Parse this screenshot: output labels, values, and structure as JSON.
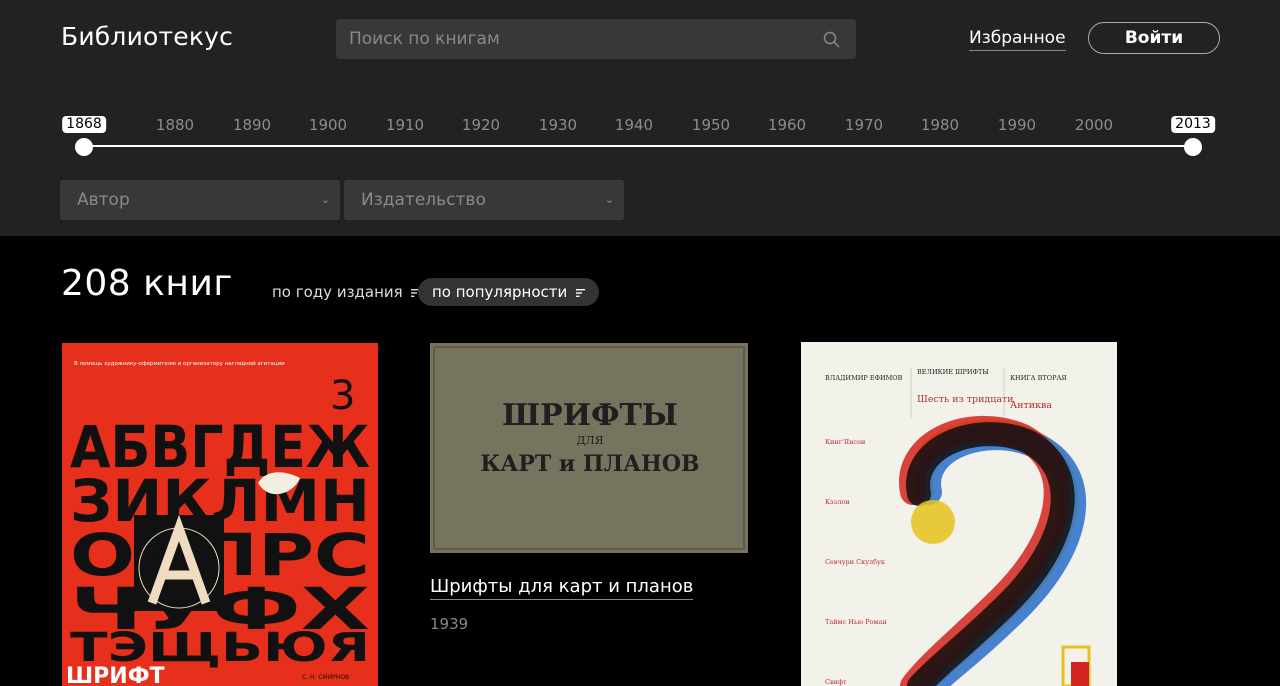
{
  "header": {
    "logo": "Библиотекус",
    "search_placeholder": "Поиск по книгам",
    "favorites": "Избранное",
    "login": "Войти"
  },
  "timeline": {
    "start": "1868",
    "end": "2013",
    "ticks": [
      "1880",
      "1890",
      "1900",
      "1910",
      "1920",
      "1930",
      "1940",
      "1950",
      "1960",
      "1970",
      "1980",
      "1990",
      "2000"
    ]
  },
  "filters": {
    "author": "Автор",
    "publisher": "Издательство"
  },
  "results": {
    "count": "208 книг",
    "sort_year": "по году издания",
    "sort_popularity": "по популярности"
  },
  "books": [
    {
      "cover": {
        "note": "В помощь художнику-оформителю и организатору наглядной агитации",
        "number": "3",
        "rows": [
          "АБВГДЕЖ",
          "ЗИКЛМН",
          "ОАПРС",
          "ЧУФХ",
          "ТЭЩЬЮЯ"
        ],
        "word": "ШРИФТ",
        "author": "С. Н. СМИРНОВ"
      }
    },
    {
      "title": "Шрифты для карт и планов",
      "year": "1939",
      "cover": {
        "line1": "ШРИФТЫ",
        "line2": "ДЛЯ",
        "line3": "КАРТ и ПЛАНОВ"
      }
    },
    {
      "cover": {
        "author": "ВЛАДИМИР ЕФИМОВ",
        "series": "ВЕЛИКИЕ ШРИФТЫ",
        "subtitle": "Шесть из тридцати",
        "book": "КНИГА ВТОРАЯ",
        "book_title": "Антиква",
        "fonts": [
          "Кинг'Янсон",
          "Кэзлон",
          "Севчури Скулбук",
          "Таймс Нью Роман",
          "Свифт"
        ]
      }
    }
  ]
}
